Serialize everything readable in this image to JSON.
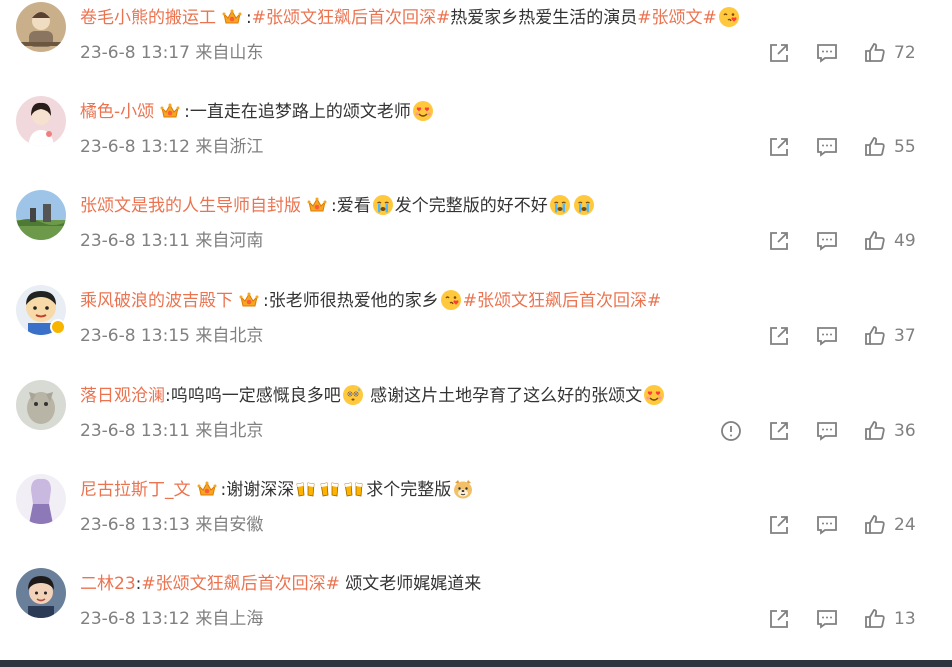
{
  "comments": [
    {
      "user": "卷毛小熊的搬运工",
      "crown": true,
      "parts": [
        {
          "t": "text",
          "v": ":"
        },
        {
          "t": "tag",
          "v": "#张颂文狂飙后首次回深#"
        },
        {
          "t": "text",
          "v": "热爱家乡热爱生活的演员"
        },
        {
          "t": "tag",
          "v": "#张颂文#"
        },
        {
          "t": "emo",
          "v": " ",
          "icon": "kiss-face-emoji"
        }
      ],
      "time": "23-6-8 13:17 来自山东",
      "likes": "72",
      "report": false
    },
    {
      "user": "橘色-小颂",
      "crown": true,
      "parts": [
        {
          "t": "text",
          "v": ":一直走在追梦路上的颂文老师"
        },
        {
          "t": "emo",
          "v": " ",
          "icon": "heart-eyes-emoji"
        }
      ],
      "time": "23-6-8 13:12 来自浙江",
      "likes": "55",
      "report": false
    },
    {
      "user": "张颂文是我的人生导师自封版",
      "crown": true,
      "parts": [
        {
          "t": "text",
          "v": ":爱看"
        },
        {
          "t": "emo",
          "v": " ",
          "icon": "crying-face-emoji"
        },
        {
          "t": "text",
          "v": "发个完整版的好不好"
        },
        {
          "t": "emo",
          "v": " ",
          "icon": "crying-face-emoji"
        },
        {
          "t": "emo",
          "v": " ",
          "icon": "crying-face-emoji"
        }
      ],
      "time": "23-6-8 13:11 来自河南",
      "likes": "49",
      "report": false
    },
    {
      "user": "乘风破浪的波吉殿下",
      "crown": true,
      "verified": true,
      "parts": [
        {
          "t": "text",
          "v": ":张老师很热爱他的家乡"
        },
        {
          "t": "emo",
          "v": " ",
          "icon": "kiss-face-emoji"
        },
        {
          "t": "tag",
          "v": "#张颂文狂飙后首次回深#"
        }
      ],
      "time": "23-6-8 13:15 来自北京",
      "likes": "37",
      "report": false
    },
    {
      "user": "落日观沧澜",
      "crown": false,
      "parts": [
        {
          "t": "text",
          "v": ":呜呜呜一定感慨良多吧"
        },
        {
          "t": "emo",
          "v": " ",
          "icon": "sweat-face-emoji"
        },
        {
          "t": "text",
          "v": " 感谢这片土地孕育了这么好的张颂文"
        },
        {
          "t": "emo",
          "v": " ",
          "icon": "heart-eyes-emoji"
        }
      ],
      "time": "23-6-8 13:11 来自北京",
      "likes": "36",
      "report": true
    },
    {
      "user": "尼古拉斯丁_文",
      "crown": true,
      "parts": [
        {
          "t": "text",
          "v": ":谢谢深深"
        },
        {
          "t": "emo",
          "v": " ",
          "icon": "cheers-emoji"
        },
        {
          "t": "emo",
          "v": " ",
          "icon": "cheers-emoji"
        },
        {
          "t": "emo",
          "v": " ",
          "icon": "cheers-emoji"
        },
        {
          "t": "text",
          "v": "求个完整版"
        },
        {
          "t": "emo",
          "v": " ",
          "icon": "doge-emoji"
        }
      ],
      "time": "23-6-8 13:13 来自安徽",
      "likes": "24",
      "report": false
    },
    {
      "user": "二林23",
      "crown": false,
      "parts": [
        {
          "t": "text",
          "v": ":"
        },
        {
          "t": "tag",
          "v": "#张颂文狂飙后首次回深#"
        },
        {
          "t": "text",
          "v": " 颂文老师娓娓道来"
        }
      ],
      "time": "23-6-8 13:12 来自上海",
      "likes": "13",
      "report": false
    }
  ],
  "icons": {
    "share": "share-icon",
    "reply": "comment-icon",
    "like": "thumbs-up-icon",
    "report": "report-icon",
    "crown": "crown-fan-badge-icon"
  },
  "colors": {
    "username": "#eb7350",
    "hashtag": "#eb7350",
    "text": "#333333",
    "meta": "#808080",
    "icon": "#808080"
  }
}
